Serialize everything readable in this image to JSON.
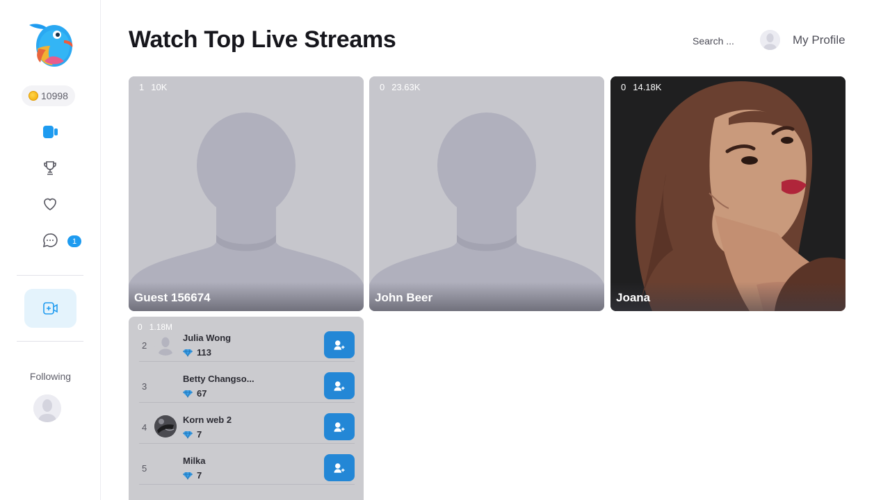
{
  "sidebar": {
    "coins": "10998",
    "nav_badge": "1",
    "following_label": "Following",
    "accent": "#1e9bf0"
  },
  "header": {
    "title": "Watch Top Live Streams",
    "search_placeholder": "Search ...",
    "profile_label": "My Profile"
  },
  "streams": [
    {
      "viewers": "1",
      "likes": "10K",
      "name": "Guest 156674"
    },
    {
      "viewers": "0",
      "likes": "23.63K",
      "name": "John Beer"
    },
    {
      "viewers": "0",
      "likes": "14.18K",
      "name": "Joana"
    }
  ],
  "leaderboard": {
    "viewers": "0",
    "likes": "1.18M",
    "rows": [
      {
        "rank": "2",
        "name": "Julia Wong",
        "score": "113"
      },
      {
        "rank": "3",
        "name": "Betty Changso...",
        "score": "67"
      },
      {
        "rank": "4",
        "name": "Korn web 2",
        "score": "7"
      },
      {
        "rank": "5",
        "name": "Milka",
        "score": "7"
      }
    ]
  }
}
